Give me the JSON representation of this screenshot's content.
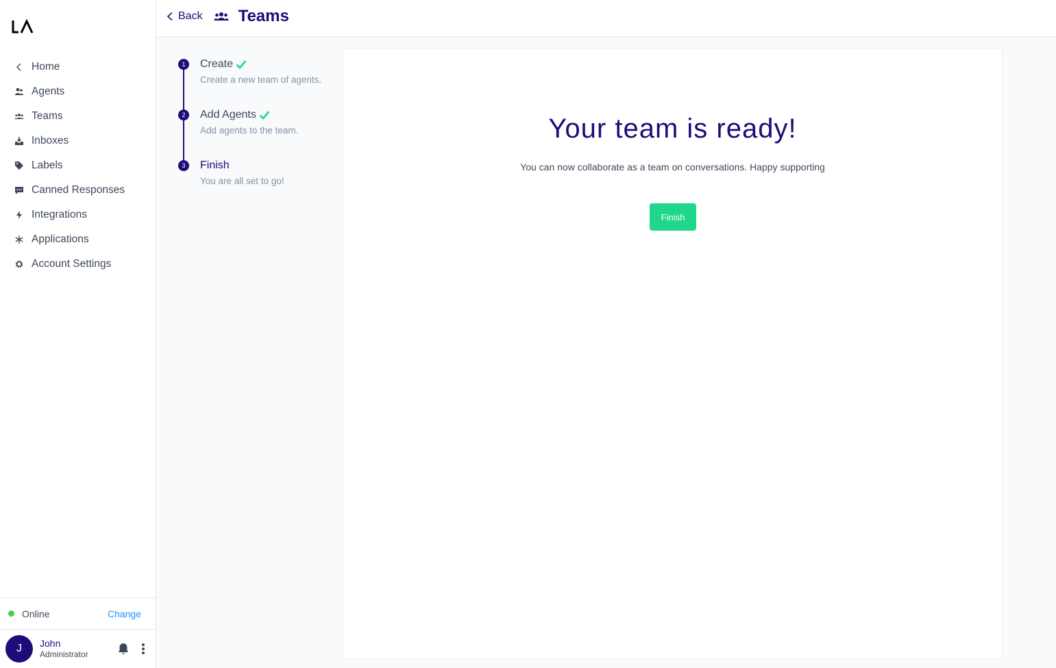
{
  "sidebar": {
    "items": [
      {
        "label": "Home",
        "icon": "chevron-left-icon"
      },
      {
        "label": "Agents",
        "icon": "agents-icon"
      },
      {
        "label": "Teams",
        "icon": "teams-icon"
      },
      {
        "label": "Inboxes",
        "icon": "inbox-icon"
      },
      {
        "label": "Labels",
        "icon": "tag-icon"
      },
      {
        "label": "Canned Responses",
        "icon": "chat-icon"
      },
      {
        "label": "Integrations",
        "icon": "flash-icon"
      },
      {
        "label": "Applications",
        "icon": "asterisk-icon"
      },
      {
        "label": "Account Settings",
        "icon": "gear-icon"
      }
    ],
    "status": {
      "text": "Online",
      "change": "Change"
    },
    "profile": {
      "initial": "J",
      "name": "John",
      "role": "Administrator"
    }
  },
  "header": {
    "back": "Back",
    "title": "Teams"
  },
  "steps": [
    {
      "number": "1",
      "title": "Create",
      "desc": "Create a new team of agents.",
      "done": true
    },
    {
      "number": "2",
      "title": "Add Agents",
      "desc": "Add agents to the team.",
      "done": true
    },
    {
      "number": "3",
      "title": "Finish",
      "desc": "You are all set to go!",
      "done": false
    }
  ],
  "card": {
    "title": "Your team is ready!",
    "subtitle": "You can now collaborate as a team on conversations. Happy supporting",
    "button": "Finish"
  },
  "colors": {
    "primary": "#1f0b79",
    "success": "#1fd68a",
    "online": "#44ce4b",
    "link": "#1f93ff"
  }
}
